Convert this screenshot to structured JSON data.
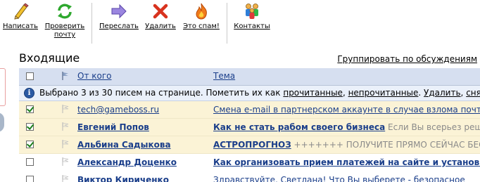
{
  "toolbar": {
    "compose": "Написать",
    "check_mail": "Проверить почту",
    "forward": "Переслать",
    "delete": "Удалить",
    "spam": "Это спам!",
    "contacts": "Контакты"
  },
  "folder_title": "Входящие",
  "group_link": "Группировать по обсуждениям",
  "columns": {
    "from": "От кого",
    "subject": "Тема"
  },
  "selection_info": {
    "text_before": "Выбрано 3 из 30 писем на странице. Пометить их как ",
    "read_link": "прочитанные",
    "comma1": ", ",
    "unread_link": "непрочитанные",
    "dot": ". ",
    "delete_link": "Удалить",
    "comma2": ", ",
    "remove_link": "снять выд"
  },
  "messages": [
    {
      "from": "tech@gameboss.ru",
      "subject": "Смена e-mail в партнерском аккаунте в случае взлома почтово",
      "preview": "",
      "checked": true,
      "unread": false
    },
    {
      "from": "Евгений Попов",
      "subject": "Как не стать рабом своего бизнеса",
      "preview": " Если Вы всерьез реши",
      "checked": true,
      "unread": true
    },
    {
      "from": "Альбина Садыкова",
      "subject": "АСТРОПРОГНОЗ",
      "preview": " +++++++ ПОЛУЧИТЕ ПРЯМО СЕЙЧАС БЕС",
      "checked": true,
      "unread": true
    },
    {
      "from": "Александр Доценко",
      "subject": "Как организовать прием платежей на сайте и установить",
      "preview": "",
      "checked": false,
      "unread": true
    },
    {
      "from": "Виктор Кириченко",
      "subject": "Здравствуйте, Светлана! Что Вы выберете - безопасное",
      "preview": "",
      "checked": false,
      "unread": true
    }
  ],
  "colors": {
    "header_bg": "#d6dff0",
    "selected_row_bg": "#fbf3d6",
    "link_blue": "#1a3e8a",
    "preview_gray": "#8a8a8a"
  }
}
